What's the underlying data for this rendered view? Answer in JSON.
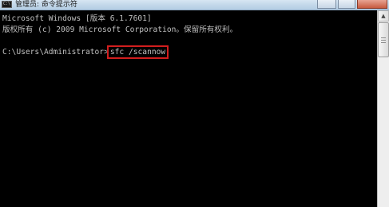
{
  "window": {
    "title": "管理员: 命令提示符",
    "icon_text": "C:\\"
  },
  "console": {
    "line1": "Microsoft Windows [版本 6.1.7601]",
    "line2": "版权所有 (c) 2009 Microsoft Corporation。保留所有权利。",
    "prompt": "C:\\Users\\Administrator>",
    "command": "sfc /scannow"
  },
  "scrollbar": {
    "up_arrow": "▲"
  },
  "colors": {
    "console_background": "#000000",
    "console_text": "#c0c0c0",
    "highlight_border": "#d21e1e"
  }
}
